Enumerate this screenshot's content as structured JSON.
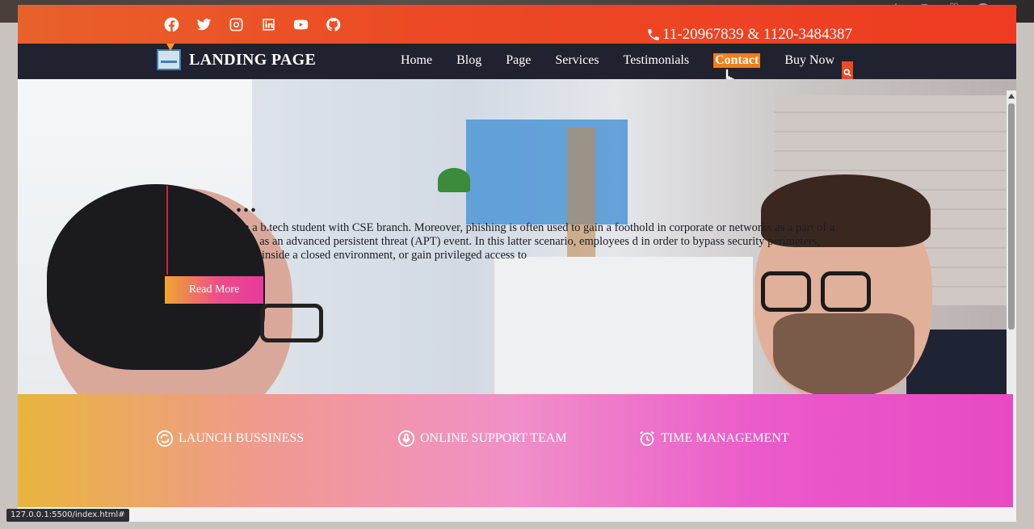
{
  "browser": {
    "icons": [
      "star-outline-icon",
      "extensions-icon",
      "collections-icon",
      "profile-icon",
      "more-icon"
    ]
  },
  "topbar": {
    "social_icons": [
      "facebook-icon",
      "twitter-icon",
      "instagram-icon",
      "linkedin-icon",
      "youtube-icon",
      "github-icon"
    ],
    "phone": "11-20967839 & 1120-3484387",
    "bg_color": "#ee3b22"
  },
  "navbar": {
    "brand": "LANDING PAGE",
    "links": [
      "Home",
      "Blog",
      "Page",
      "Services",
      "Testimonials",
      "Contact",
      "Buy Now"
    ],
    "active": "Contact",
    "accent": "#f07e1e"
  },
  "hero": {
    "heading": "...",
    "text": "ita Maurya. I am a b.tech student with CSE branch. Moreover, phishing is often used to gain a foothold in corporate or networks as a part of a larger attack, such as an advanced persistent threat (APT) event. In this latter scenario, employees d in order to bypass security perimeters, distribute malware inside a closed environment, or gain privileged access to",
    "button": "Read More"
  },
  "features": [
    {
      "icon": "rotate-icon",
      "label": "LAUNCH BUSSINESS"
    },
    {
      "icon": "microphone-icon",
      "label": "ONLINE SUPPORT TEAM"
    },
    {
      "icon": "alarm-clock-icon",
      "label": "TIME MANAGEMENT"
    }
  ],
  "status": {
    "url": "127.0.0.1:5500/index.html#"
  }
}
